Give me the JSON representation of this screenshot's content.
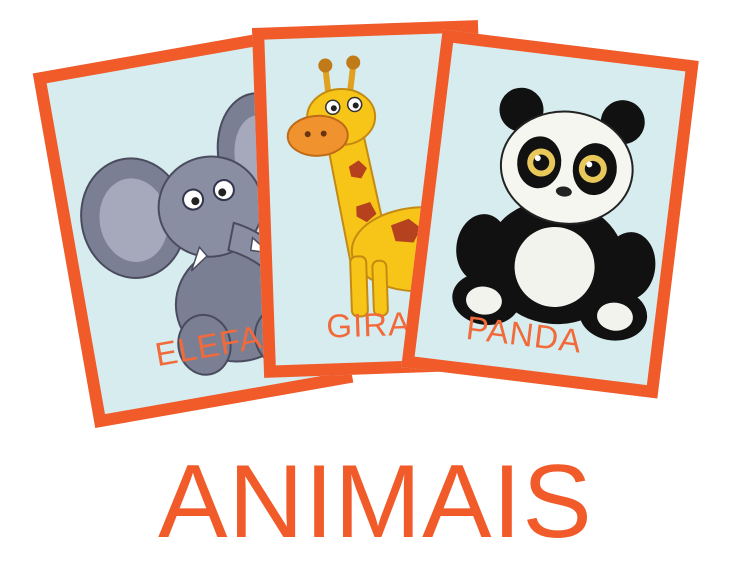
{
  "cards": [
    {
      "id": "elephant",
      "label": "ELEFA",
      "icon": "elephant-icon"
    },
    {
      "id": "giraffe",
      "label": "GIRAF",
      "icon": "giraffe-icon"
    },
    {
      "id": "panda",
      "label": "PANDA",
      "icon": "panda-icon"
    }
  ],
  "title": "ANIMAIS",
  "colors": {
    "accent": "#f15a29",
    "card_background": "#d6ecef",
    "label_text": "#f26a3a"
  }
}
